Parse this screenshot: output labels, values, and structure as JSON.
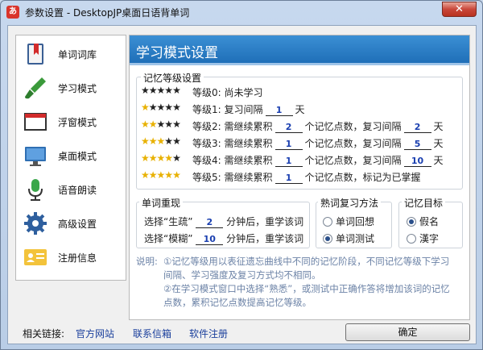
{
  "window": {
    "app_icon_text": "あ",
    "title": "参数设置 - DesktopJP桌面日语背单词",
    "close_symbol": "✕"
  },
  "sidebar": {
    "items": [
      {
        "label": "单词词库",
        "icon": "book-icon"
      },
      {
        "label": "学习模式",
        "icon": "brush-icon"
      },
      {
        "label": "浮窗模式",
        "icon": "window-icon"
      },
      {
        "label": "桌面模式",
        "icon": "monitor-icon"
      },
      {
        "label": "语音朗读",
        "icon": "microphone-icon"
      },
      {
        "label": "高级设置",
        "icon": "gear-icon"
      },
      {
        "label": "注册信息",
        "icon": "id-card-icon"
      }
    ]
  },
  "main": {
    "title": "学习模式设置",
    "memory_levels": {
      "group_title": "记忆等级设置",
      "levels": [
        {
          "stars_on": 0,
          "prefix": "等级0:",
          "text": "尚未学习"
        },
        {
          "stars_on": 1,
          "prefix": "等级1:",
          "text_a": "复习间隔",
          "interval": "1",
          "text_b": "天"
        },
        {
          "stars_on": 2,
          "prefix": "等级2:",
          "text_a": "需继续累积",
          "points": "2",
          "text_b": "个记忆点数，复习间隔",
          "interval": "2",
          "text_c": "天"
        },
        {
          "stars_on": 3,
          "prefix": "等级3:",
          "text_a": "需继续累积",
          "points": "1",
          "text_b": "个记忆点数，复习间隔",
          "interval": "5",
          "text_c": "天"
        },
        {
          "stars_on": 4,
          "prefix": "等级4:",
          "text_a": "需继续累积",
          "points": "1",
          "text_b": "个记忆点数，复习间隔",
          "interval": "10",
          "text_c": "天"
        },
        {
          "stars_on": 5,
          "prefix": "等级5:",
          "text_a": "需继续累积",
          "points": "1",
          "text_b": "个记忆点数，标记为已掌握"
        }
      ]
    },
    "word_repeat": {
      "group_title": "单词重现",
      "row1": {
        "a": "选择“生疏”",
        "value": "2",
        "b": "分钟后，重学该词"
      },
      "row2": {
        "a": "选择“模糊”",
        "value": "10",
        "b": "分钟后，重学该词"
      }
    },
    "review_method": {
      "group_title": "熟词复习方法",
      "options": [
        {
          "label": "单词回想",
          "selected": false
        },
        {
          "label": "单词测试",
          "selected": true
        }
      ]
    },
    "memory_target": {
      "group_title": "记忆目标",
      "options": [
        {
          "label": "假名",
          "selected": true
        },
        {
          "label": "漢字",
          "selected": false
        }
      ]
    },
    "note": {
      "label": "说明:",
      "line1": "①记忆等级用以表征遗忘曲线中不同的记忆阶段，不同记忆等级下学习",
      "line2": "间隔、学习强度及复习方式均不相同。",
      "line3": "②在学习模式窗口中选择“熟悉”，或测试中正确作答将增加该词的记忆",
      "line4": "点数，累积记忆点数提高记忆等级。"
    }
  },
  "footer": {
    "links_label": "相关链接:",
    "links": [
      "官方网站",
      "联系信箱",
      "软件注册"
    ],
    "ok_label": "确定"
  },
  "colors": {
    "banner": "#1f6fb8",
    "link": "#1a3f9c",
    "star_on": "#e8b100",
    "note": "#6b82a6"
  }
}
